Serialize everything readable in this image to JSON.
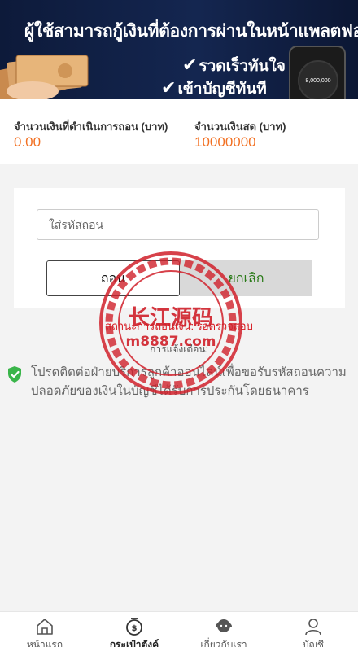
{
  "banner": {
    "title": "ผู้ใช้สามารถกู้เงินที่ต้องการผ่านในหน้าแพลตฟอร์ม",
    "line1": "รวดเร็วทันใจ",
    "line2": "เข้าบัญชีทันที",
    "phone_amount": "8,000,000"
  },
  "summary": {
    "in_progress_label": "จำนวนเงินที่ดำเนินการถอน (บาท)",
    "in_progress_value": "0.00",
    "cash_label": "จำนวนเงินสด (บาท)",
    "cash_value": "10000000"
  },
  "form": {
    "code_placeholder": "ใส่รหัสถอน",
    "withdraw_label": "ถอน",
    "cancel_label": "ยกเลิก"
  },
  "status_text": "สถานะการถอนเงิน: รอตรวจสอบ",
  "notify_text": "การแจ้งเตือน:",
  "notice": {
    "text": "โปรดติดต่อฝ่ายบริการลูกค้าออนไลน์เพื่อขอรับรหัสถอนความปลอดภัยของเงินในบัญชีได้รับการประกันโดยธนาคาร"
  },
  "watermark": {
    "title": "长江源码",
    "url": "m8887.com"
  },
  "tabs": [
    {
      "label": "หน้าแรก",
      "icon": "home-icon"
    },
    {
      "label": "กระเป๋าตังค์",
      "icon": "wallet-icon"
    },
    {
      "label": "เกี่ยวกับเรา",
      "icon": "support-icon"
    },
    {
      "label": "บัญชี",
      "icon": "user-icon"
    }
  ],
  "colors": {
    "accent": "#f27022",
    "cancel_text": "#2a7a18",
    "status": "#d71920",
    "shield": "#3ab54a"
  }
}
